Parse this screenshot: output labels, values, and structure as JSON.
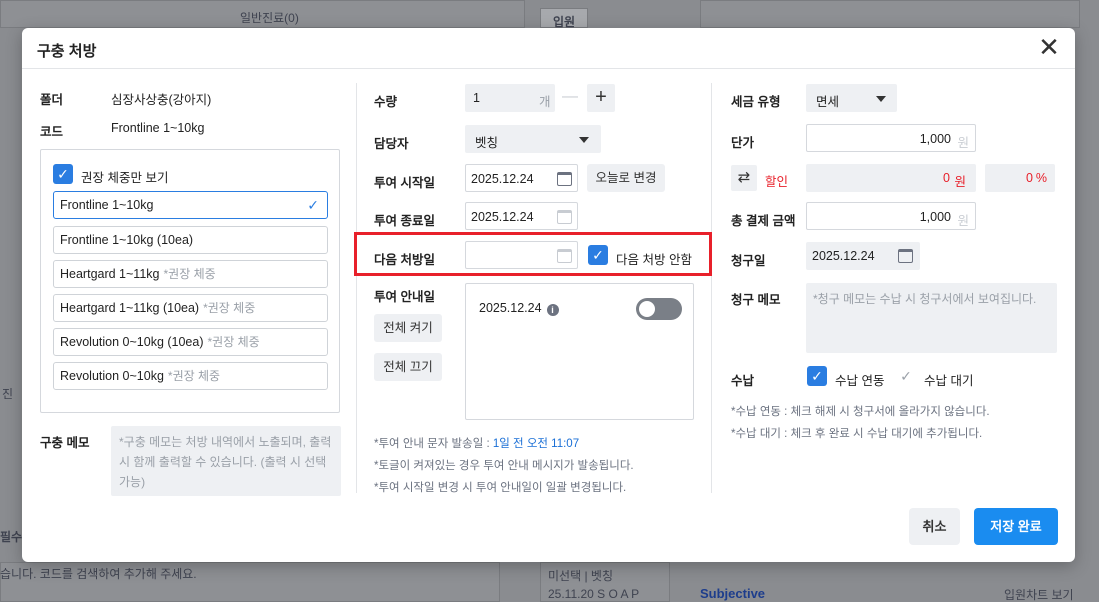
{
  "background": {
    "dropdown_label": "일반진료(0)",
    "tab_label": "입원",
    "left_cut_text": "진",
    "bottom_cut_label": "필수",
    "bottom_hint": "습니다. 코드를 검색하여 추가해 주세요.",
    "bottom_record1": "미선택 | 벳칭",
    "bottom_record2": "25.11.20 S O A P",
    "subjective": "Subjective",
    "inpatient_chart_btn": "입원차트 보기"
  },
  "modal": {
    "title": "구충 처방",
    "close_icon": "close-icon"
  },
  "left": {
    "folder_label": "폴더",
    "folder_value": "심장사상충(강아지)",
    "code_label": "코드",
    "code_value": "Frontline 1~10kg",
    "recommend_only_label": "권장 체중만 보기",
    "items": [
      {
        "name": "Frontline 1~10kg",
        "tag": ""
      },
      {
        "name": "Frontline 1~10kg (10ea)",
        "tag": ""
      },
      {
        "name": "Heartgard 1~11kg",
        "tag": "*권장 체중"
      },
      {
        "name": "Heartgard 1~11kg (10ea)",
        "tag": "*권장 체중"
      },
      {
        "name": "Revolution 0~10kg (10ea)",
        "tag": "*권장 체중"
      },
      {
        "name": "Revolution 0~10kg",
        "tag": "*권장 체중"
      }
    ],
    "memo_label": "구충 메모",
    "memo_placeholder": "*구충 메모는 처방 내역에서 노출되며, 출력 시 함께 출력할 수 있습니다. (출력 시 선택 가능)"
  },
  "middle": {
    "qty_label": "수량",
    "qty_value": "1",
    "qty_unit": "개",
    "minus": "—",
    "plus": "+",
    "manager_label": "담당자",
    "manager_value": "벳칭",
    "start_label": "투여 시작일",
    "start_value": "2025.12.24",
    "today_btn": "오늘로 변경",
    "end_label": "투여 종료일",
    "end_value": "2025.12.24",
    "next_label": "다음 처방일",
    "next_value": "",
    "no_next_label": "다음 처방 안함",
    "guide_label": "투여 안내일",
    "all_on": "전체 켜기",
    "all_off": "전체 끄기",
    "guide_date": "2025.12.24",
    "info_icon": "i",
    "note1_prefix": "*투여 안내 문자 발송일 : ",
    "note1_hl": "1일 전 오전 11:07",
    "note2": "*토글이 켜져있는 경우 투여 안내 메시지가 발송됩니다.",
    "note3": "*투여 시작일 변경 시 투여 안내일이 일괄 변경됩니다."
  },
  "right": {
    "tax_label": "세금 유형",
    "tax_value": "면세",
    "price_label": "단가",
    "price_value": "1,000",
    "won": "원",
    "discount_label": "할인",
    "discount_value": "0",
    "discount_won": "원",
    "discount_pct": "0",
    "pct": "%",
    "swap_icon": "⇄",
    "total_label": "총 결제 금액",
    "total_value": "1,000",
    "bill_date_label": "청구일",
    "bill_date_value": "2025.12.24",
    "bill_memo_label": "청구 메모",
    "bill_memo_placeholder": "*청구 메모는 수납 시 청구서에서 보여집니다.",
    "receipt_label": "수납",
    "receipt_link": "수납 연동",
    "receipt_wait": "수납 대기",
    "note1": "*수납 연동 : 체크 해제 시 청구서에 올라가지 않습니다.",
    "note2": "*수납 대기 : 체크 후 완료 시 수납 대기에 추가됩니다."
  },
  "footer": {
    "cancel": "취소",
    "save": "저장 완료"
  },
  "colors": {
    "primary": "#1a8cf0",
    "checkbox": "#2a7de1",
    "highlight_border": "#e8202a",
    "discount_red": "#e8202a"
  }
}
